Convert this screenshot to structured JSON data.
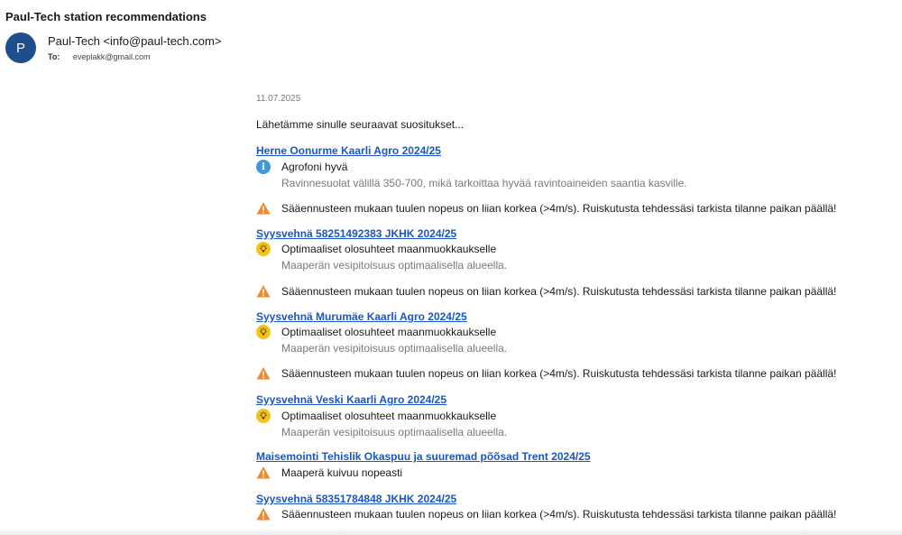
{
  "email": {
    "subject": "Paul-Tech station recommendations",
    "avatar_letter": "P",
    "sender": "Paul-Tech <info@paul-tech.com>",
    "to_label": "To:",
    "to_address": "eveplakk@gmail.com"
  },
  "body": {
    "date": "11.07.2025",
    "intro": "Lähetämme sinulle seuraavat suositukset...",
    "fields": [
      {
        "title": "Herne Oonurme Kaarli Agro 2024/25",
        "recs": [
          {
            "icon": "info-icon",
            "main": "Agrofoni hyvä",
            "sub": "Ravinnesuolat välillä 350-700, mikä tarkoittaa hyvää ravintoaineiden saantia kasville."
          },
          {
            "icon": "warning-icon",
            "main": "Sääennusteen mukaan tuulen nopeus on liian korkea (>4m/s). Ruiskutusta tehdessäsi tarkista tilanne paikan päällä!",
            "sub": ""
          }
        ]
      },
      {
        "title": "Syysvehnä 58251492383 JKHK 2024/25",
        "recs": [
          {
            "icon": "lightbulb-icon",
            "main": "Optimaaliset olosuhteet maanmuokkaukselle",
            "sub": "Maaperän vesipitoisuus optimaalisella alueella."
          },
          {
            "icon": "warning-icon",
            "main": "Sääennusteen mukaan tuulen nopeus on liian korkea (>4m/s). Ruiskutusta tehdessäsi tarkista tilanne paikan päällä!",
            "sub": ""
          }
        ]
      },
      {
        "title": "Syysvehnä Murumäe Kaarli Agro 2024/25",
        "recs": [
          {
            "icon": "lightbulb-icon",
            "main": "Optimaaliset olosuhteet maanmuokkaukselle",
            "sub": "Maaperän vesipitoisuus optimaalisella alueella."
          },
          {
            "icon": "warning-icon",
            "main": "Sääennusteen mukaan tuulen nopeus on liian korkea (>4m/s). Ruiskutusta tehdessäsi tarkista tilanne paikan päällä!",
            "sub": ""
          }
        ]
      },
      {
        "title": "Syysvehnä Veski Kaarli Agro 2024/25",
        "recs": [
          {
            "icon": "lightbulb-icon",
            "main": "Optimaaliset olosuhteet maanmuokkaukselle",
            "sub": "Maaperän vesipitoisuus optimaalisella alueella."
          }
        ]
      },
      {
        "title": "Maisemointi Tehislik Okaspuu ja suuremad põõsad Trent 2024/25",
        "recs": [
          {
            "icon": "warning-icon",
            "main": "Maaperä kuivuu nopeasti",
            "sub": ""
          }
        ]
      },
      {
        "title": "Syysvehnä 58351784848 JKHK 2024/25",
        "recs": [
          {
            "icon": "warning-icon",
            "main": "Sääennusteen mukaan tuulen nopeus on liian korkea (>4m/s). Ruiskutusta tehdessäsi tarkista tilanne paikan päällä!",
            "sub": ""
          }
        ]
      }
    ]
  },
  "colors": {
    "link": "#1a56c4",
    "avatar": "#1f4e8c",
    "info": "#3f9ad9",
    "bulb": "#f2c417",
    "warning": "#ee8a2a"
  }
}
